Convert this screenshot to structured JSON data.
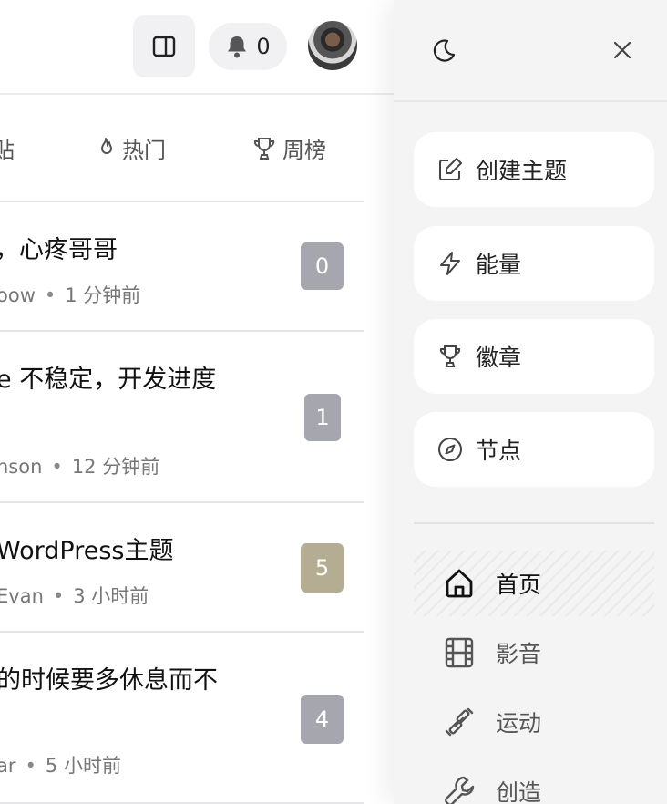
{
  "header": {
    "notification_count": "0",
    "icons": {
      "sidebar_toggle": "sidebar-panel-icon",
      "bell": "bell-icon",
      "avatar": "user-avatar"
    }
  },
  "tabs": [
    {
      "label": "贴",
      "icon": ""
    },
    {
      "label": "热门",
      "icon": "flame-icon"
    },
    {
      "label": "周榜",
      "icon": "trophy-icon"
    }
  ],
  "posts": [
    {
      "title_line1": "，心疼哥哥",
      "title_line2": "",
      "author": "oow",
      "time": "1 分钟前",
      "replies": "0",
      "badge_color": "#a6a6af"
    },
    {
      "title_line1": "e 不稳定，开发进度",
      "title_line2": "",
      "author": "nson",
      "time": "12 分钟前",
      "replies": "1",
      "badge_color": "#a6a6af"
    },
    {
      "title_line1": "WordPress主题",
      "title_line2": "",
      "author": "Evan",
      "time": "3 小时前",
      "replies": "5",
      "badge_color": "#b5ad93"
    },
    {
      "title_line1": "的时候要多休息而不",
      "title_line2": "",
      "author": "ar",
      "time": "5 小时前",
      "replies": "4",
      "badge_color": "#a6a6af"
    }
  ],
  "drawer": {
    "icons": {
      "theme": "moon-icon",
      "close": "close-icon"
    },
    "cards": [
      {
        "label": "创建主题",
        "icon": "edit-icon"
      },
      {
        "label": "能量",
        "icon": "lightning-icon"
      },
      {
        "label": "徽章",
        "icon": "trophy-icon"
      },
      {
        "label": "节点",
        "icon": "compass-icon"
      }
    ],
    "nav": [
      {
        "label": "首页",
        "icon": "home-icon",
        "active": true
      },
      {
        "label": "影音",
        "icon": "film-icon",
        "active": false
      },
      {
        "label": "运动",
        "icon": "dumbbell-icon",
        "active": false
      },
      {
        "label": "创造",
        "icon": "wrench-icon",
        "active": false
      }
    ]
  }
}
